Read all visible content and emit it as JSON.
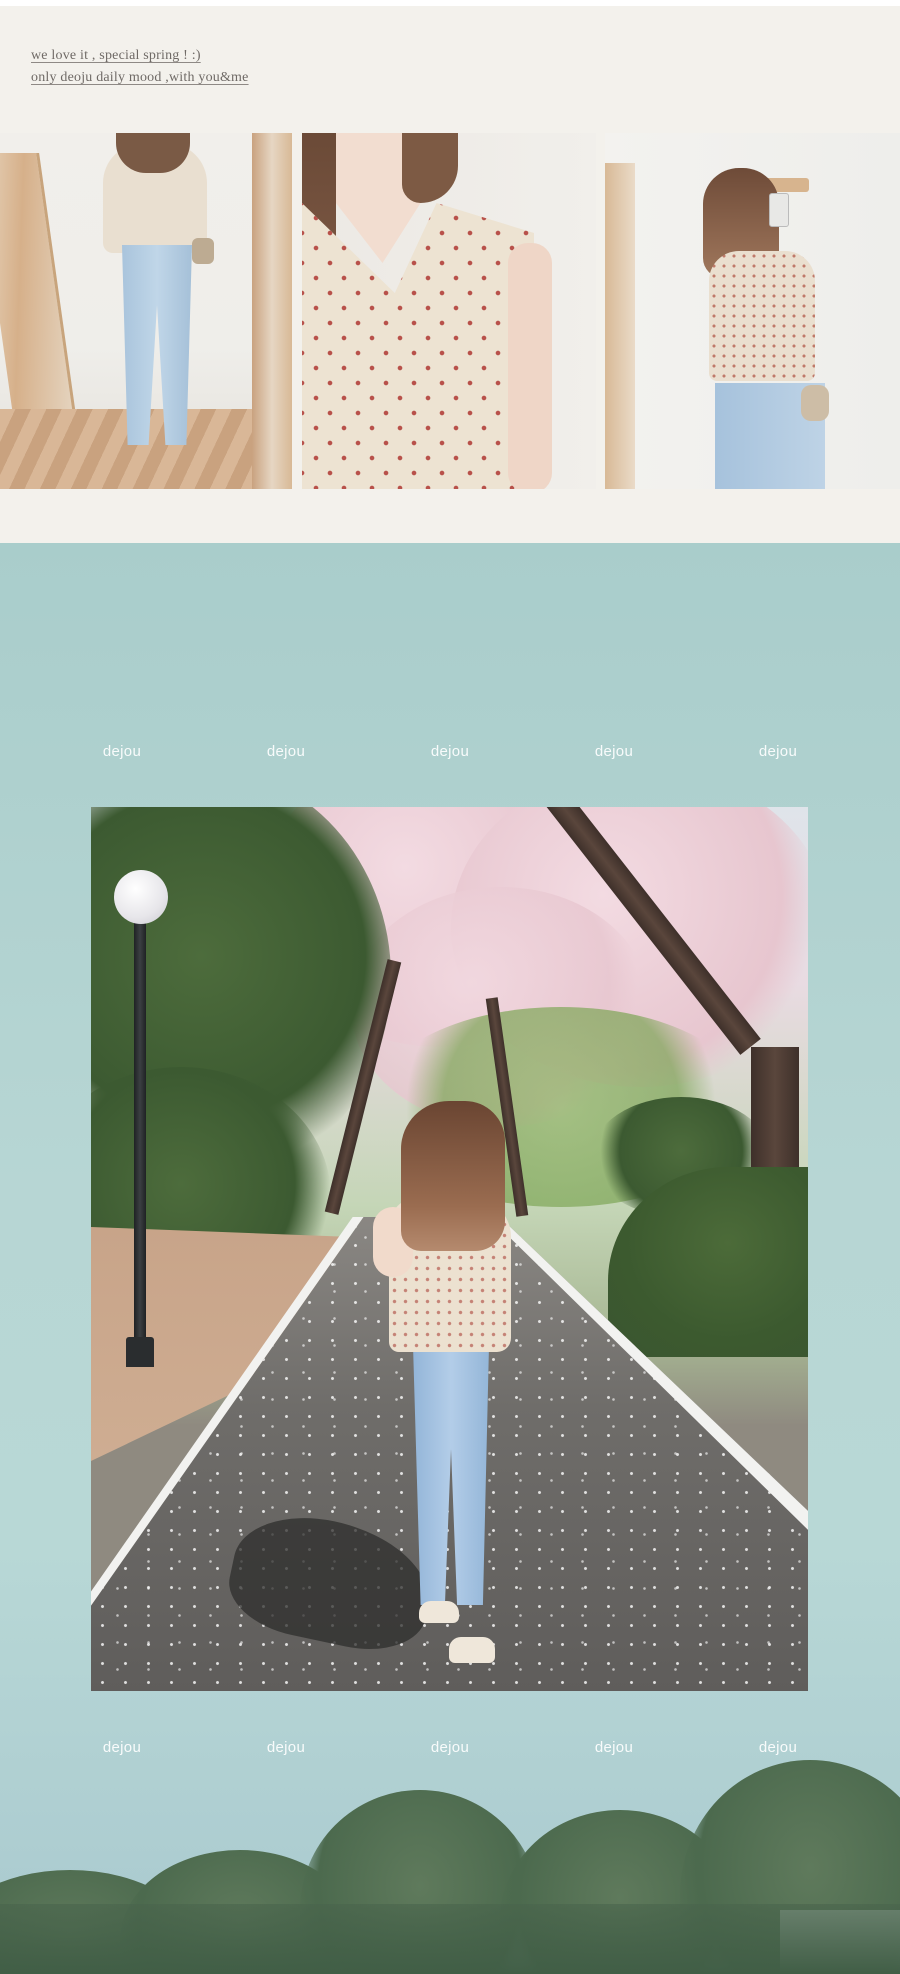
{
  "header": {
    "line1": "we love it , special spring ! :)",
    "line2": "only deoju daily mood ,with you&me"
  },
  "watermarks": {
    "top_row": [
      "dejou",
      "dejou",
      "dejou",
      "dejou",
      "dejou"
    ],
    "bottom_row": [
      "dejou",
      "dejou",
      "dejou",
      "dejou",
      "dejou"
    ]
  },
  "colors": {
    "cream_background": "#f3f1ec",
    "teal_background": "#b7d6d4",
    "tagline_text": "#6f6a66",
    "watermark_text": "#ffffff"
  }
}
